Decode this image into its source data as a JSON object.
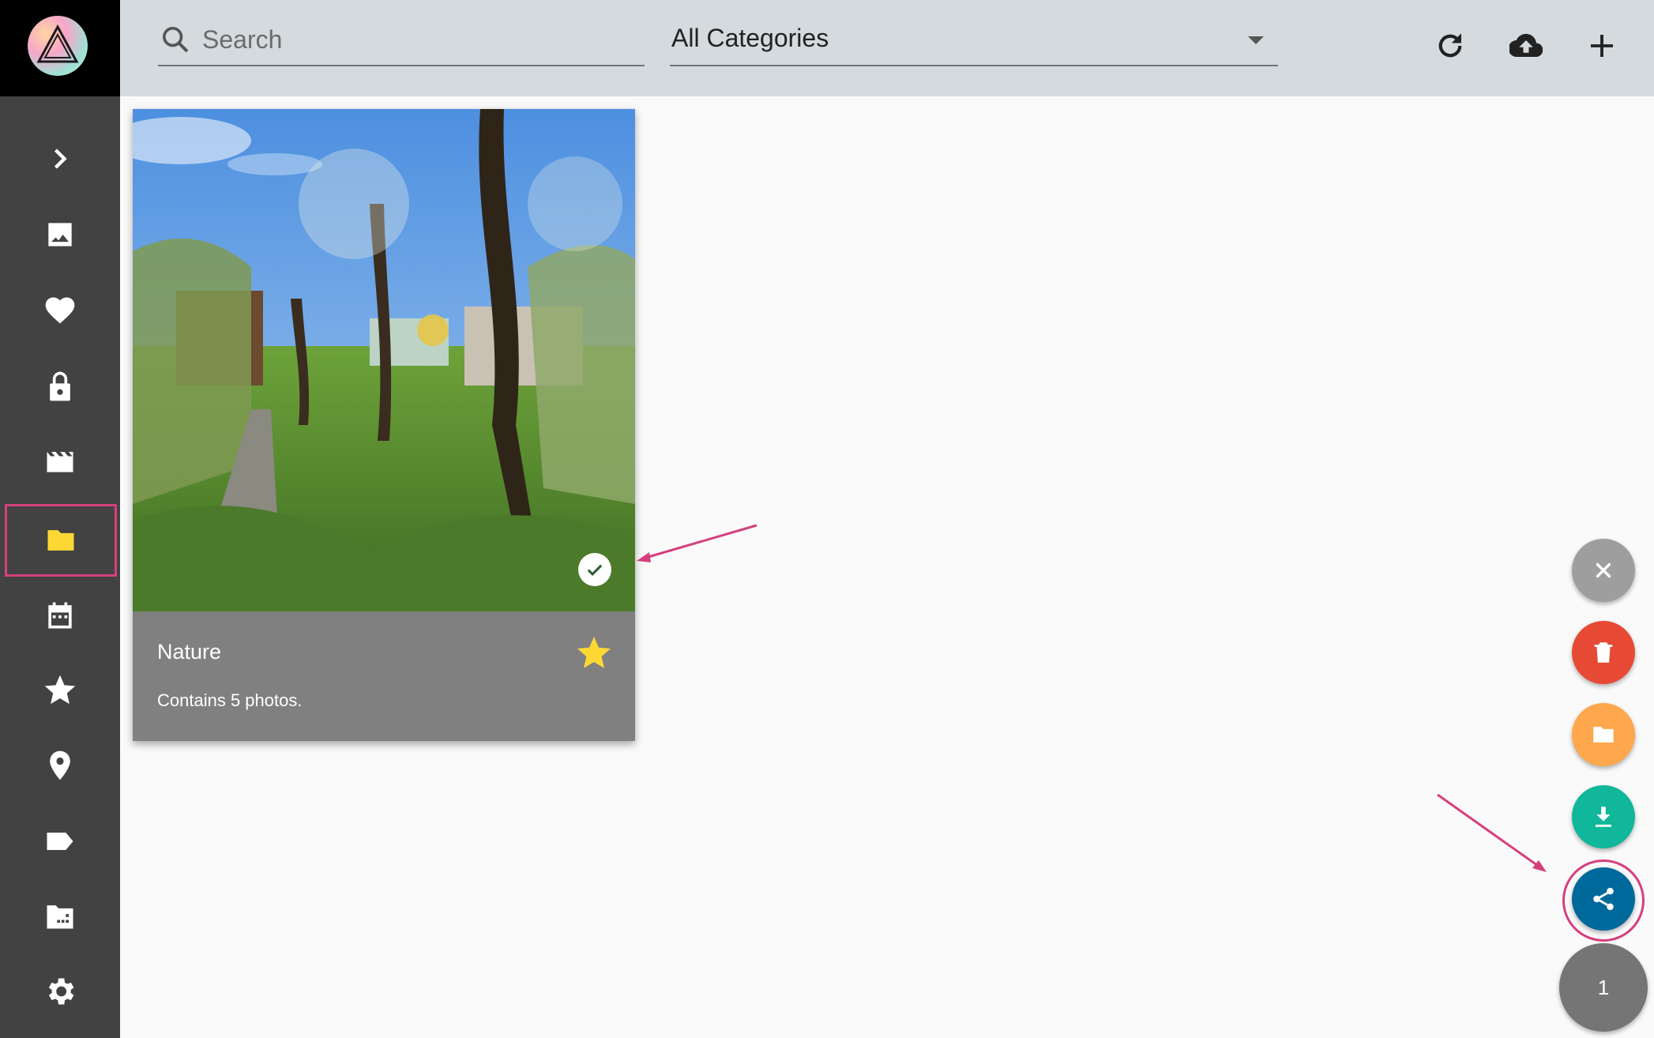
{
  "search": {
    "placeholder": "Search",
    "value": ""
  },
  "category_select": {
    "value": "All Categories"
  },
  "toolbar": {
    "icons": [
      "refresh-icon",
      "cloud-upload-icon",
      "plus-icon"
    ]
  },
  "sidebar": {
    "items": [
      {
        "icon": "chevron-right-icon"
      },
      {
        "icon": "image-icon"
      },
      {
        "icon": "heart-icon"
      },
      {
        "icon": "lock-icon"
      },
      {
        "icon": "video-icon"
      },
      {
        "icon": "folder-icon",
        "active": true
      },
      {
        "icon": "calendar-icon"
      },
      {
        "icon": "star-icon"
      },
      {
        "icon": "location-pin-icon"
      },
      {
        "icon": "label-icon"
      },
      {
        "icon": "film-folder-icon"
      },
      {
        "icon": "settings-gear-icon"
      }
    ]
  },
  "album": {
    "title": "Nature",
    "description": "Contains 5 photos.",
    "favorite": true,
    "selected": true
  },
  "selection": {
    "count": "1"
  },
  "fab_actions": [
    "close-icon",
    "delete-icon",
    "folder-icon",
    "download-icon",
    "share-icon"
  ],
  "colors": {
    "sidebar": "#424242",
    "toolbar": "#d4dadd",
    "accent_yellow": "#fdd835",
    "highlight": "#d63f7d",
    "fab_close": "#9e9e9e",
    "fab_delete": "#e64a35",
    "fab_folder": "#ffa74d",
    "fab_download": "#10b79a",
    "fab_share": "#00699b",
    "fab_count": "#757575"
  }
}
